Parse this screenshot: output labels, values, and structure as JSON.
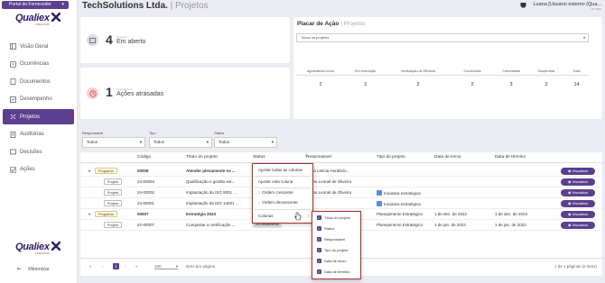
{
  "sidebar": {
    "portal": "Portal do Fornecedor",
    "brand": "Qualiex",
    "brand_sub": "FORLOGIC",
    "items": [
      {
        "label": "Visão Geral",
        "icon": "dashboard-icon"
      },
      {
        "label": "Ocorrências",
        "icon": "warning-icon"
      },
      {
        "label": "Documentos",
        "icon": "document-icon"
      },
      {
        "label": "Desempenho",
        "icon": "chart-icon"
      },
      {
        "label": "Projetos",
        "icon": "projects-icon"
      },
      {
        "label": "Auditorias",
        "icon": "audit-icon"
      },
      {
        "label": "Decisões",
        "icon": "decision-icon"
      },
      {
        "label": "Ações",
        "icon": "actions-icon"
      }
    ],
    "minimize": "Minimizar",
    "accent": "#5c3f8f"
  },
  "header": {
    "company": "TechSolutions Ltda.",
    "sep": "|",
    "section": "Projetos",
    "user": "Luana [Usuário externo (Qua...",
    "version": "PL.0305"
  },
  "cards": {
    "projects_count": "4",
    "projects_small": "Projetos",
    "projects_label": "Em aberto",
    "actions_count": "1",
    "actions_small": "Projetos com",
    "actions_label": "Ações atrasadas"
  },
  "placar": {
    "title": "Placar de Ação",
    "sep": "|",
    "sub": "Projetos",
    "select": "Todos os projetos",
    "headers": [
      "Aguardando início",
      "Em execução",
      "Verificação de Eficácia",
      "Concluídas",
      "Canceladas",
      "Suspensas",
      "Total"
    ],
    "values": [
      "2",
      "3",
      "2",
      "2",
      "3",
      "2",
      "14"
    ]
  },
  "filters": [
    {
      "label": "Responsável",
      "value": "Todos"
    },
    {
      "label": "Tipo",
      "value": "Todos"
    },
    {
      "label": "Status",
      "value": "Todos"
    }
  ],
  "table": {
    "headers": [
      "Código",
      "Título do projeto",
      "Status",
      "Responsável",
      "Tipo do projeto",
      "Data de início",
      "Data de término"
    ],
    "button": "Visualizar",
    "rows": [
      {
        "tag": "Programa",
        "code": "00008",
        "title": "Atender plenamente os ...",
        "status": "",
        "resp": "Carla Letícia Hordécio...",
        "type": "",
        "start": "",
        "end": "",
        "program": true
      },
      {
        "tag": "Projeto",
        "code": "24-00004",
        "title": "Qualificação e gestão est...",
        "status": "",
        "resp": "Luana Leonel de Oliveira",
        "type": "",
        "start": "",
        "end": "",
        "program": false
      },
      {
        "tag": "Projeto",
        "code": "24-00002",
        "title": "Implantação da ISO 9001 ...",
        "status": "",
        "resp": "Luana Leonel de Oliveira",
        "type": "Iniciativa estratégica",
        "start": "",
        "end": "",
        "program": false
      },
      {
        "tag": "Projeto",
        "code": "24-00001",
        "title": "Implantação da ISO 14001 ...",
        "status": "",
        "resp": "",
        "type": "Iniciativa estratégica",
        "start": "",
        "end": "",
        "program": false
      },
      {
        "tag": "Programa",
        "code": "00007",
        "title": "Estratégia 2023",
        "status": "",
        "resp": "",
        "type": "Planejamento Estratégico",
        "start": "1 de dez. de 2022",
        "end": "1 de dez. de 2023",
        "program": true
      },
      {
        "tag": "Projeto",
        "code": "22-00007",
        "title": "Conquistar a certificação ...",
        "status": "Em andamento",
        "resp": "",
        "type": "Planejamento Estratégico",
        "start": "1 de jan. de 2023",
        "end": "1 de jan. de 2023",
        "program": false
      }
    ],
    "pager": {
      "first": "«",
      "prev": "‹",
      "page": "1",
      "next": "›",
      "last": "»",
      "page_size": "100",
      "per_page_label": "itens por página",
      "summary": "1 de 1 páginas (6 itens)"
    }
  },
  "column_menu": {
    "items": [
      "Ajustar todas as colunas",
      "Ajustar esta coluna",
      "Ordem crescente",
      "Ordem decrescente",
      "Colunas"
    ],
    "columns": [
      "Título do projeto",
      "Status",
      "Responsável",
      "Tipo do projeto",
      "Data de início",
      "Data de término"
    ]
  }
}
